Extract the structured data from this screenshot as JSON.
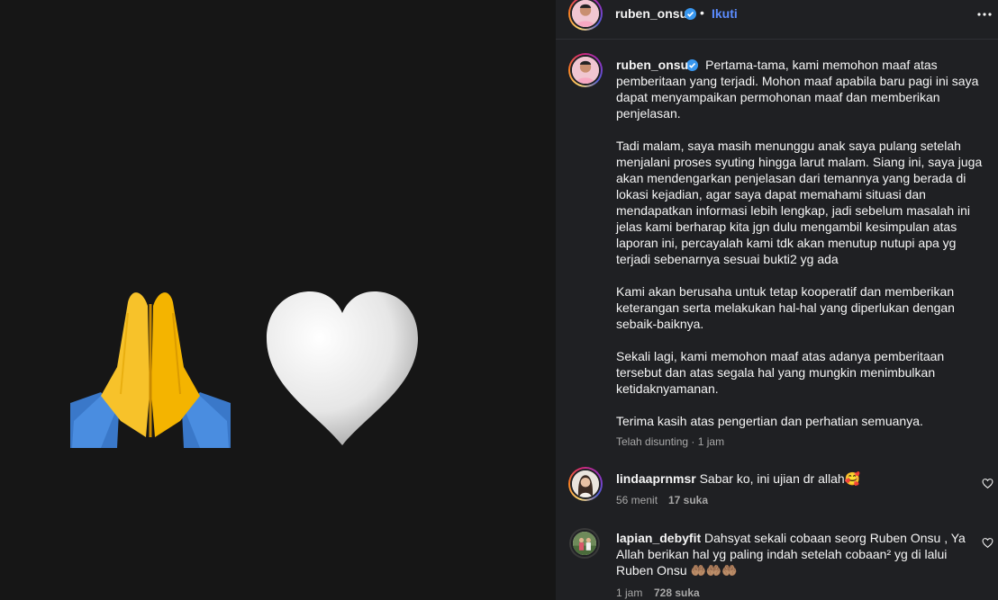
{
  "post": {
    "author": "ruben_onsu",
    "follow_label": "Ikuti",
    "separator": "•"
  },
  "media": {
    "emojis": [
      "folded-hands-emoji",
      "white-heart-emoji"
    ]
  },
  "caption": {
    "author": "ruben_onsu",
    "paragraphs": [
      "Pertama-tama, kami memohon maaf atas pemberitaan yang terjadi. Mohon maaf apabila baru pagi ini saya dapat menyampaikan permohonan maaf dan memberikan penjelasan.",
      "Tadi malam, saya masih menunggu anak saya pulang setelah menjalani proses syuting hingga larut malam. Siang ini, saya juga akan mendengarkan penjelasan dari temannya yang berada di lokasi kejadian, agar saya dapat memahami situasi dan mendapatkan informasi lebih lengkap, jadi sebelum masalah ini jelas kami berharap kita jgn dulu mengambil kesimpulan atas laporan ini, percayalah kami tdk akan menutup nutupi apa yg terjadi sebenarnya sesuai bukti2 yg ada",
      "Kami akan berusaha untuk tetap kooperatif dan memberikan keterangan serta melakukan hal-hal yang diperlukan dengan sebaik-baiknya.",
      "Sekali lagi, kami memohon maaf atas adanya pemberitaan tersebut dan atas segala hal yang mungkin menimbulkan ketidaknyamanan.",
      "Terima kasih atas pengertian dan perhatian semuanya."
    ],
    "meta": "Telah disunting · 1 jam"
  },
  "comments": [
    {
      "author": "lindaaprnmsr",
      "text": "Sabar ko, ini ujian dr allah🥰",
      "time": "56 menit",
      "likes": "17 suka"
    },
    {
      "author": "lapian_debyfit",
      "text": "Dahsyat sekali cobaan seorg Ruben Onsu , Ya Allah berikan hal yg paling indah setelah cobaan² yg di lalui Ruben Onsu 🤲🏽🤲🏽🤲🏽",
      "time": "1 jam",
      "likes": "728 suka"
    }
  ],
  "colors": {
    "panel_bg": "#1f2023",
    "media_bg": "#161616",
    "accent_link": "#5b8cff",
    "verified": "#3897f0",
    "muted": "#a8a8a8"
  }
}
